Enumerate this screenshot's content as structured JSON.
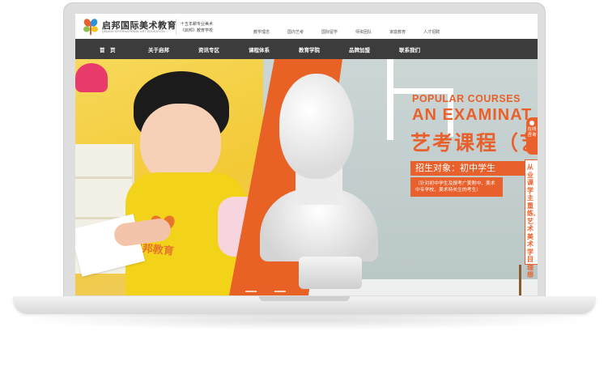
{
  "header": {
    "logo_name": "启邦国际美术教育",
    "logo_sub": "QIBANG INTERNATIONAL ART EDUCATION",
    "slogan_line1": "十五年耕专业美术",
    "slogan_line2": "《启邦》教育学校",
    "top_links": [
      "教学理念",
      "国内艺考",
      "国际留学",
      "师资团队",
      "家庭教育",
      "人才招聘"
    ]
  },
  "nav": {
    "items": [
      "首　页",
      "关于启邦",
      "资讯专区",
      "课程体系",
      "教育学院",
      "品牌加盟",
      "联系我们"
    ]
  },
  "banner": {
    "title_line1": "POPULAR COURSES",
    "title_line2": "AN EXAMINAT",
    "title_line3": "艺考课程（艺",
    "target": "招生对象：初中学生",
    "desc": "（针对初中学生及报考广美附中、美术中专学校、美术特长生的考生）",
    "side_text": "从业课学主重练,艺术美术学目理想",
    "apron_text": "启邦教育",
    "float_consult": "在线咨询",
    "active_slide": 1,
    "slide_count": 3
  },
  "colors": {
    "accent": "#e8612c",
    "nav_bg": "#3c3c3c",
    "apron": "#f3d21a"
  }
}
